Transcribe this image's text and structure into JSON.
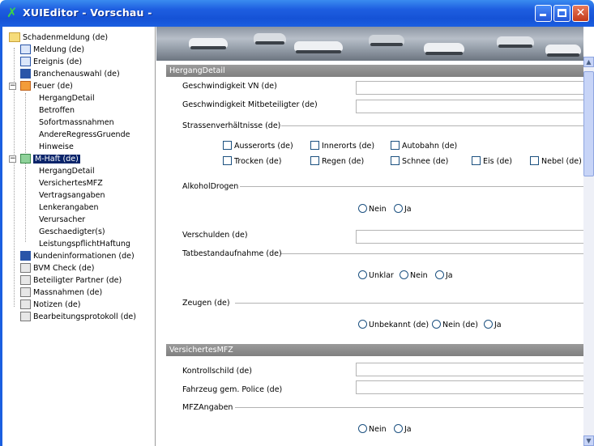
{
  "window": {
    "title": "XUIEditor - Vorschau -"
  },
  "tree": {
    "items": [
      {
        "label": "Schadenmeldung (de)",
        "icon": "folder-icon"
      },
      {
        "label": "Meldung (de)",
        "icon": "form-icon"
      },
      {
        "label": "Ereignis (de)",
        "icon": "lightning-icon"
      },
      {
        "label": "Branchenauswahl (de)",
        "icon": "columns-icon"
      },
      {
        "label": "Feuer (de)",
        "icon": "fire-icon"
      },
      {
        "label": "HergangDetail"
      },
      {
        "label": "Betroffen"
      },
      {
        "label": "Sofortmassnahmen"
      },
      {
        "label": "AndereRegressGruende"
      },
      {
        "label": "Hinweise"
      },
      {
        "label": "M-Haft (de)",
        "icon": "car-icon"
      },
      {
        "label": "HergangDetail"
      },
      {
        "label": "VersichertesMFZ"
      },
      {
        "label": "Vertragsangaben"
      },
      {
        "label": "Lenkerangaben"
      },
      {
        "label": "Verursacher"
      },
      {
        "label": "Geschaedigter(s)"
      },
      {
        "label": "LeistungspflichtHaftung"
      },
      {
        "label": "Kundeninformationen (de)",
        "icon": "info-icon"
      },
      {
        "label": "BVM Check (de)",
        "icon": "check-icon"
      },
      {
        "label": "Beteiligter Partner (de)",
        "icon": "people-icon"
      },
      {
        "label": "Massnahmen (de)",
        "icon": "list-icon"
      },
      {
        "label": "Notizen (de)",
        "icon": "note-icon"
      },
      {
        "label": "Bearbeitungsprotokoll (de)",
        "icon": "pen-icon"
      }
    ]
  },
  "form": {
    "hergang": {
      "header": "HergangDetail",
      "speed_vn": "Geschwindigkeit VN (de)",
      "speed_mit": "Geschwindigkeit Mitbeteiligter (de)",
      "strassen": {
        "label": "Strassenverhältnisse (de)",
        "options": [
          "Ausserorts (de)",
          "Innerorts (de)",
          "Autobahn (de)",
          "Trocken (de)",
          "Regen (de)",
          "Schnee (de)",
          "Eis (de)",
          "Nebel (de)"
        ]
      },
      "alkohol": {
        "label": "AlkoholDrogen",
        "options": [
          "Nein",
          "Ja"
        ]
      },
      "verschulden": "Verschulden (de)",
      "tatbestand": {
        "label": "Tatbestandaufnahme (de)",
        "options": [
          "Unklar",
          "Nein",
          "Ja"
        ]
      },
      "zeugen": {
        "label": "Zeugen (de)",
        "options": [
          "Unbekannt (de)",
          "Nein (de)",
          "Ja"
        ]
      }
    },
    "mfz": {
      "header": "VersichertesMFZ",
      "kontrollschild": "Kontrollschild (de)",
      "fahrzeug": "Fahrzeug gem. Police (de)",
      "mfzangaben": {
        "label": "MFZAngaben",
        "options": [
          "Nein",
          "Ja"
        ]
      }
    }
  }
}
